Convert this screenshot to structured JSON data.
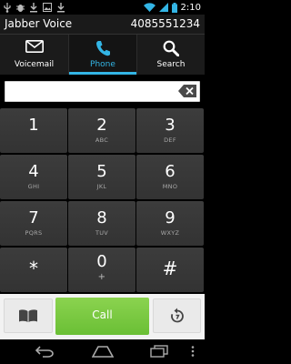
{
  "status_bar": {
    "time": "2:10",
    "icons": [
      "usb-icon",
      "debug-icon",
      "download-icon",
      "image-icon",
      "download-icon",
      "wifi-icon",
      "signal-icon",
      "battery-icon"
    ]
  },
  "app_bar": {
    "title": "Jabber Voice",
    "phone_number": "4085551234"
  },
  "tabs": [
    {
      "label": "Voicemail",
      "icon": "voicemail-icon",
      "active": false
    },
    {
      "label": "Phone",
      "icon": "phone-icon",
      "active": true
    },
    {
      "label": "Search",
      "icon": "search-icon",
      "active": false
    }
  ],
  "dial_input": {
    "value": "",
    "placeholder": ""
  },
  "keypad": [
    {
      "digit": "1",
      "letters": ""
    },
    {
      "digit": "2",
      "letters": "ABC"
    },
    {
      "digit": "3",
      "letters": "DEF"
    },
    {
      "digit": "4",
      "letters": "GHI"
    },
    {
      "digit": "5",
      "letters": "JKL"
    },
    {
      "digit": "6",
      "letters": "MNO"
    },
    {
      "digit": "7",
      "letters": "PQRS"
    },
    {
      "digit": "8",
      "letters": "TUV"
    },
    {
      "digit": "9",
      "letters": "WXYZ"
    },
    {
      "digit": "*",
      "letters": ""
    },
    {
      "digit": "0",
      "letters": "+"
    },
    {
      "digit": "#",
      "letters": ""
    }
  ],
  "actions": {
    "call_label": "Call",
    "contacts_icon": "book-icon",
    "redial_icon": "redial-icon"
  },
  "colors": {
    "accent": "#33b5e5",
    "call_green": "#6abf35"
  }
}
